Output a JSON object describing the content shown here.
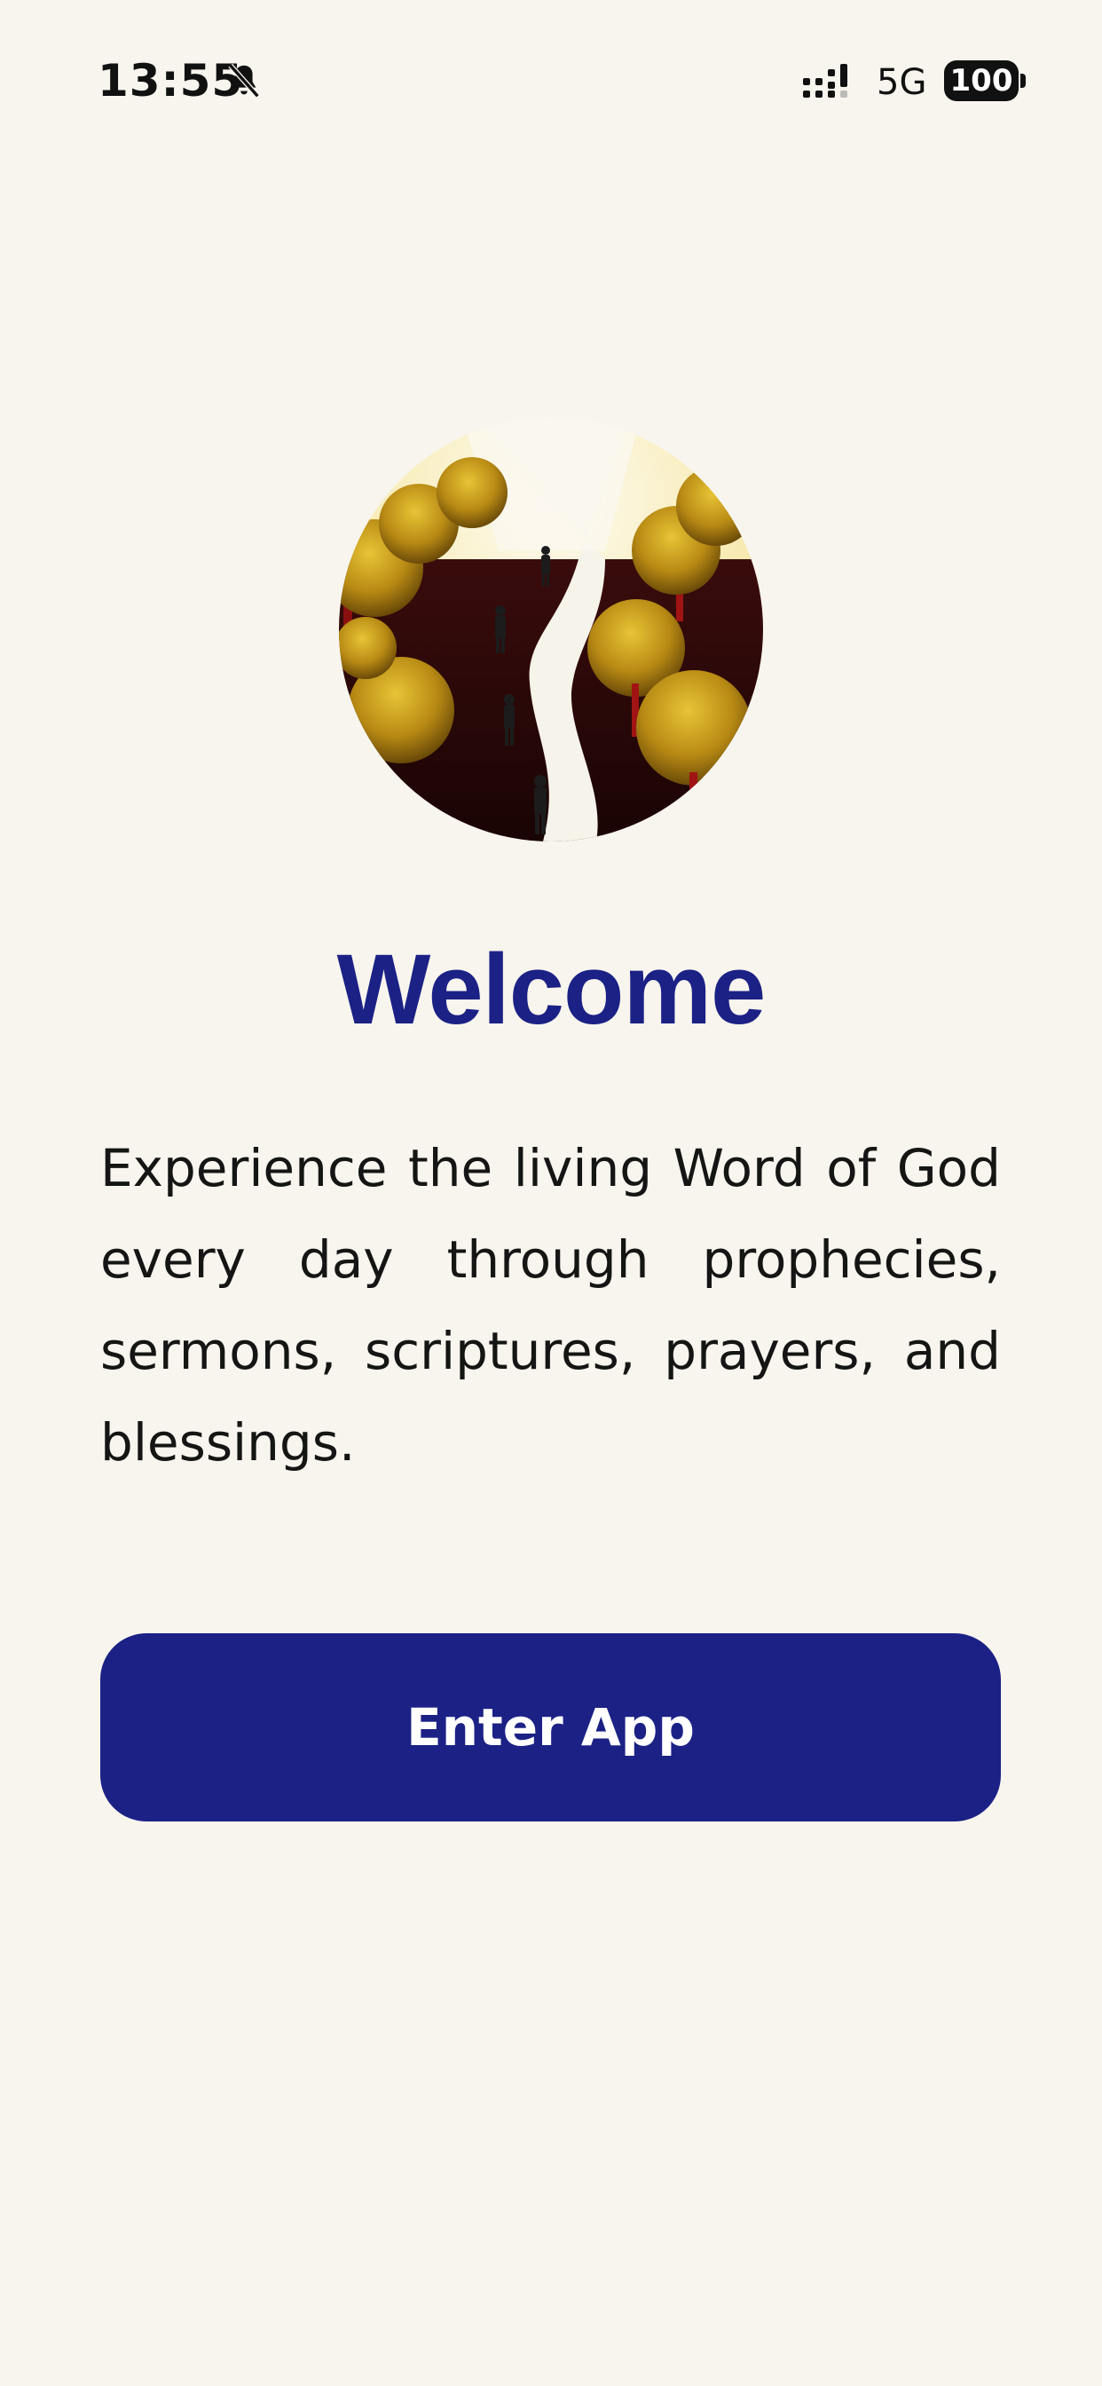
{
  "status_bar": {
    "time": "13:55",
    "network": "5G",
    "battery": "100",
    "icons": [
      "bell-slash-icon",
      "signal-icon"
    ]
  },
  "hero": {
    "icon": "path-walkers-illustration"
  },
  "welcome": {
    "title": "Welcome",
    "description": "Experience the living Word of God every day through prophecies, sermons, scriptures, prayers, and blessings."
  },
  "actions": {
    "enter_label": "Enter App"
  },
  "colors": {
    "background": "#f8f5ee",
    "accent": "#1b2185",
    "text": "#151515"
  }
}
